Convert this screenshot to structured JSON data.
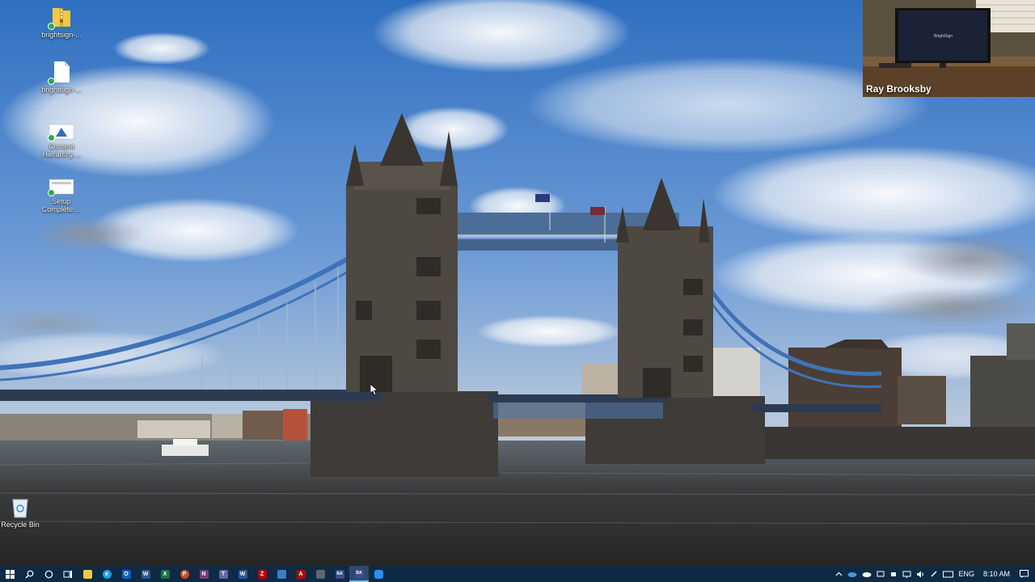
{
  "desktop": {
    "icons": [
      {
        "label": "brightsign-...",
        "icon": "zip-folder-icon"
      },
      {
        "label": "brightsign-...",
        "icon": "text-file-icon"
      },
      {
        "label": "Content\nHierarchy....",
        "icon": "document-image-icon"
      },
      {
        "label": "Setup\nComplete....",
        "icon": "document-image-icon"
      },
      {
        "label": "Recycle Bin",
        "icon": "recycle-bin-icon"
      }
    ],
    "wallpaper": "tower-bridge-london"
  },
  "webcam": {
    "participant_name": "Ray Brooksby",
    "screen_logo": "BrightSign"
  },
  "taskbar": {
    "apps": [
      {
        "name": "file-explorer",
        "color": "#f2c744",
        "glyph": ""
      },
      {
        "name": "edge",
        "color": "#1fa0e0",
        "glyph": "e"
      },
      {
        "name": "outlook",
        "color": "#0a64c8",
        "glyph": "O"
      },
      {
        "name": "word",
        "color": "#2b5797",
        "glyph": "W"
      },
      {
        "name": "excel",
        "color": "#1e7145",
        "glyph": "X"
      },
      {
        "name": "powerpoint",
        "color": "#d24726",
        "glyph": "P"
      },
      {
        "name": "onenote",
        "color": "#80397b",
        "glyph": "N"
      },
      {
        "name": "teams",
        "color": "#6264a7",
        "glyph": "T"
      },
      {
        "name": "word-2",
        "color": "#2b5797",
        "glyph": "W"
      },
      {
        "name": "filezilla",
        "color": "#bf0000",
        "glyph": "Z"
      },
      {
        "name": "app-blue",
        "color": "#3c7fc4",
        "glyph": ""
      },
      {
        "name": "acrobat",
        "color": "#b30b00",
        "glyph": "A"
      },
      {
        "name": "app-gray",
        "color": "#5c6670",
        "glyph": ""
      },
      {
        "name": "brightauthor",
        "color": "#3f4d8f",
        "glyph": "BA"
      },
      {
        "name": "brightauthor-active",
        "color": "#3f4d8f",
        "glyph": "BA"
      },
      {
        "name": "zoom",
        "color": "#2d8cff",
        "glyph": ""
      }
    ],
    "tray": {
      "language": "ENG",
      "time": "8:10 AM"
    }
  }
}
